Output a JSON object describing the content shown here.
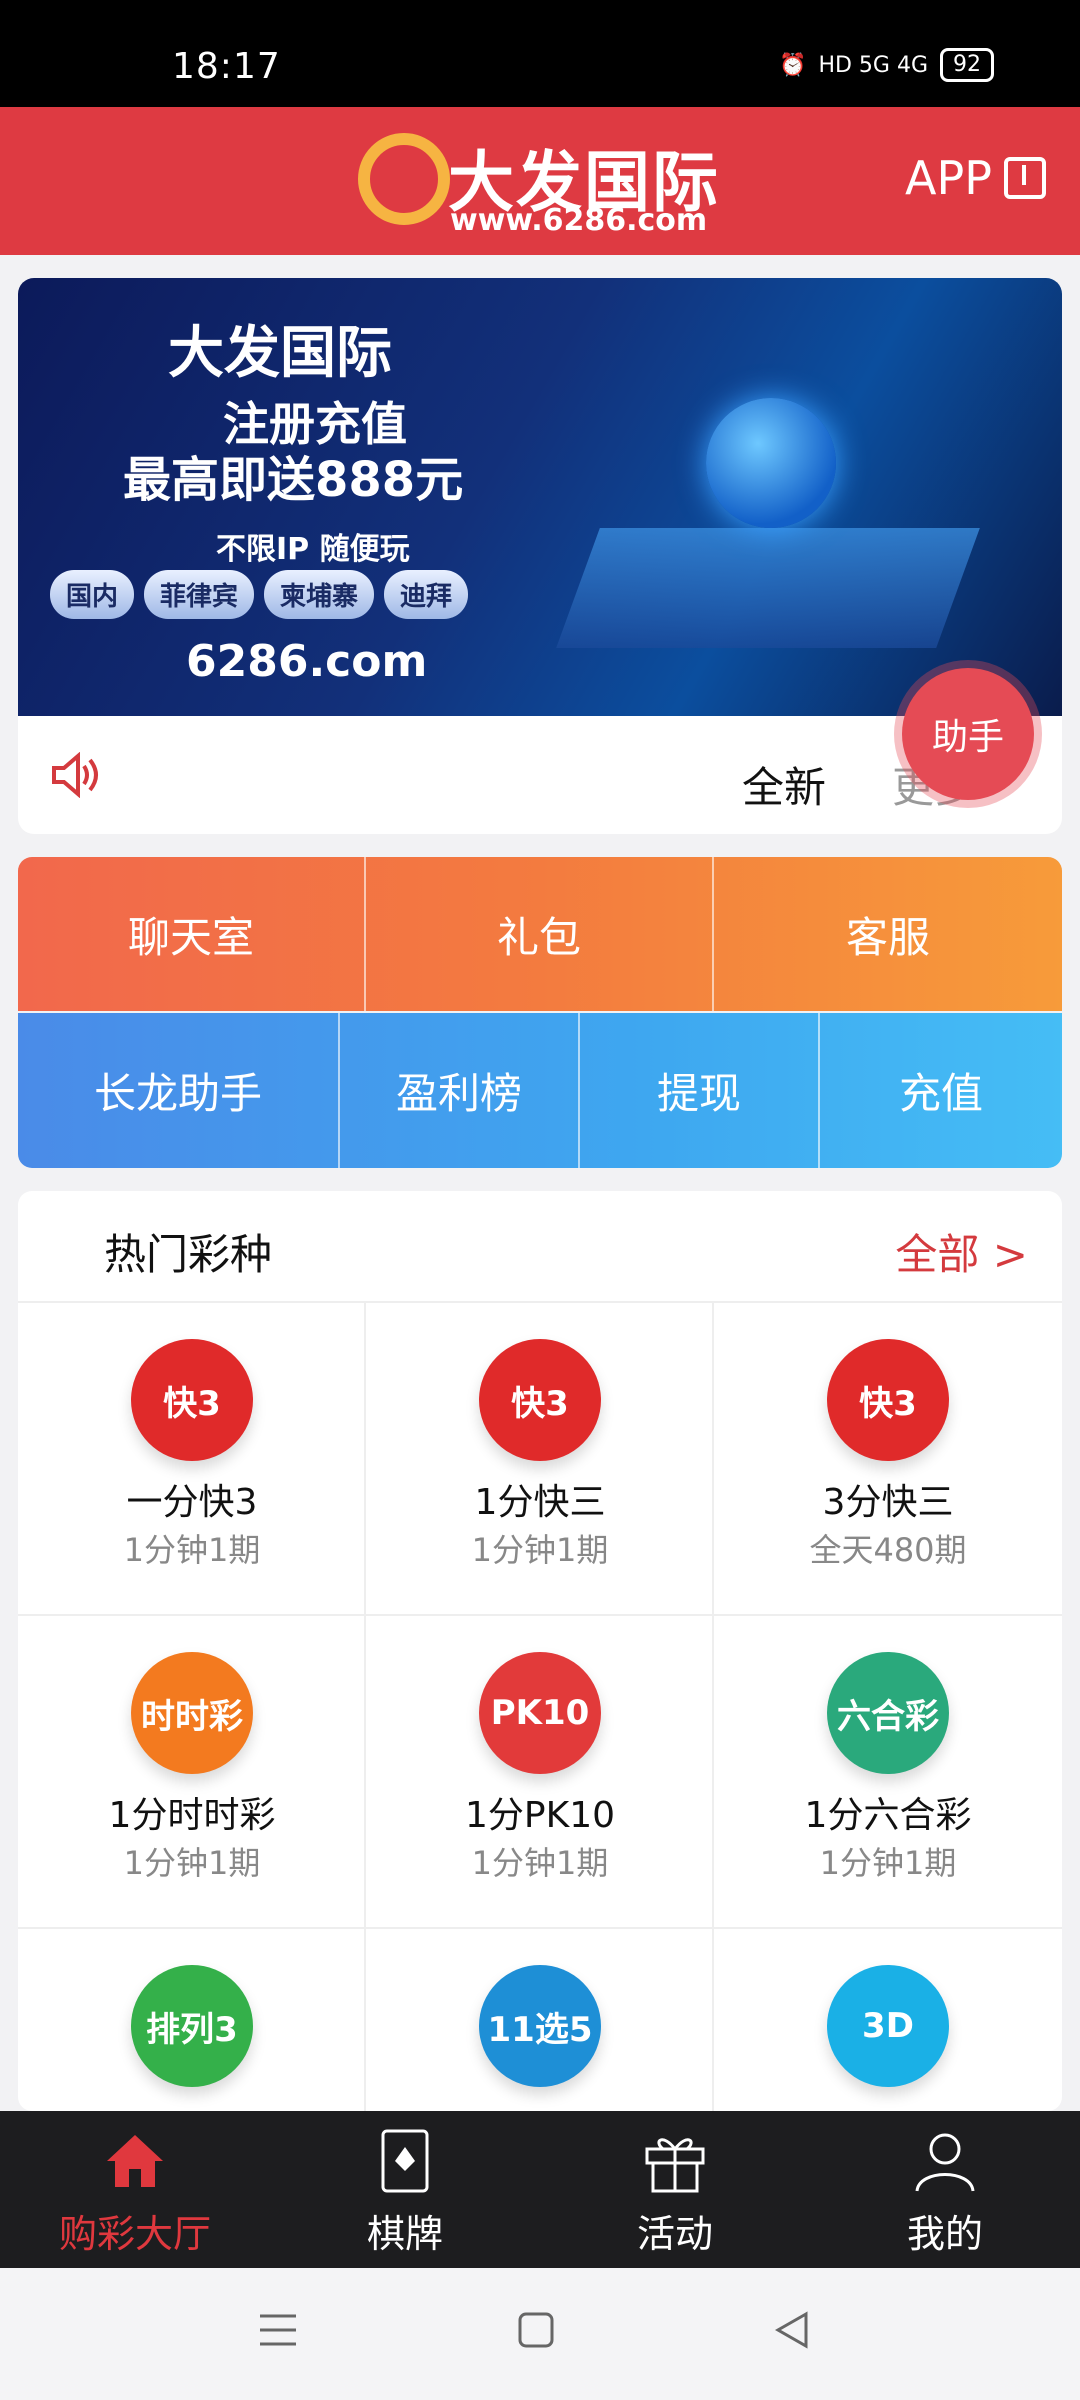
{
  "status_bar": {
    "time": "18:17",
    "network": "HD 5G 4G",
    "battery": "92"
  },
  "header": {
    "brand": "大发国际",
    "url": "www.6286.com",
    "app_label": "APP"
  },
  "banner": {
    "brand": "大发国际",
    "line1": "注册充值",
    "line2": "最高即送888元",
    "line3": "不限IP 随便玩",
    "chips": [
      "国内",
      "菲律宾",
      "柬埔寨",
      "迪拜"
    ],
    "domain": "6286.com"
  },
  "notice": {
    "text": "全新",
    "more": "更多"
  },
  "helper_label": "助手",
  "quick_row1": [
    "聊天室",
    "礼包",
    "客服"
  ],
  "quick_row2": [
    "长龙助手",
    "盈利榜",
    "提现",
    "充值"
  ],
  "lottery": {
    "title": "热门彩种",
    "all_label": "全部",
    "items": [
      {
        "name": "一分快3",
        "sub": "1分钟1期",
        "logo": "快3",
        "color": "#e02a2a"
      },
      {
        "name": "1分快三",
        "sub": "1分钟1期",
        "logo": "快3",
        "color": "#e02a2a"
      },
      {
        "name": "3分快三",
        "sub": "全天480期",
        "logo": "快3",
        "color": "#e02a2a"
      },
      {
        "name": "1分时时彩",
        "sub": "1分钟1期",
        "logo": "时时彩",
        "color": "#f37a1f"
      },
      {
        "name": "1分PK10",
        "sub": "1分钟1期",
        "logo": "PK10",
        "color": "#e23a3a"
      },
      {
        "name": "1分六合彩",
        "sub": "1分钟1期",
        "logo": "六合彩",
        "color": "#2aa97c"
      },
      {
        "name": "",
        "sub": "",
        "logo": "排列3",
        "color": "#34b04a"
      },
      {
        "name": "",
        "sub": "",
        "logo": "11选5",
        "color": "#1e8fd6"
      },
      {
        "name": "",
        "sub": "",
        "logo": "3D",
        "color": "#1ab0e6"
      }
    ]
  },
  "bottom_nav": [
    {
      "label": "购彩大厅",
      "icon": "home-icon",
      "active": true
    },
    {
      "label": "棋牌",
      "icon": "cards-icon",
      "active": false
    },
    {
      "label": "活动",
      "icon": "gift-icon",
      "active": false
    },
    {
      "label": "我的",
      "icon": "user-icon",
      "active": false
    }
  ]
}
